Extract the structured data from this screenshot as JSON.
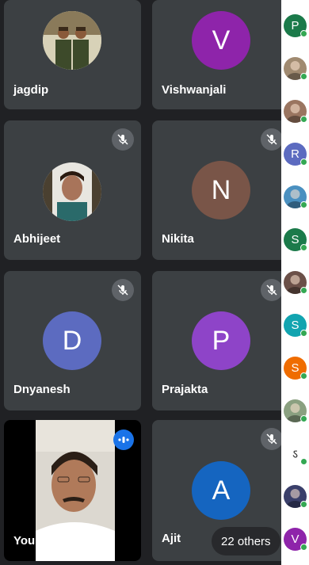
{
  "participants": {
    "jagdip": {
      "name": "jagdip"
    },
    "vishwanjali": {
      "name": "Vishwanjali",
      "initial": "V",
      "color": "#8e24aa"
    },
    "abhijeet": {
      "name": "Abhijeet"
    },
    "nikita": {
      "name": "Nikita",
      "initial": "N",
      "color": "#795548"
    },
    "dnyanesh": {
      "name": "Dnyanesh",
      "initial": "D",
      "color": "#5c6bc0"
    },
    "prajakta": {
      "name": "Prajakta",
      "initial": "P",
      "color": "#8e44c8"
    },
    "you": {
      "name": "You"
    },
    "ajit": {
      "name": "Ajit",
      "initial": "A",
      "color": "#1565c0"
    }
  },
  "others_label": "22 others",
  "sidebar": {
    "avatars": [
      {
        "kind": "letter",
        "letter": "P",
        "color": "#1b7a4a"
      },
      {
        "kind": "photo",
        "color": "#a08a70"
      },
      {
        "kind": "photo",
        "color": "#9a7560"
      },
      {
        "kind": "letter",
        "letter": "R",
        "color": "#5c6bc0"
      },
      {
        "kind": "photo",
        "color": "#4a90c0"
      },
      {
        "kind": "letter",
        "letter": "S",
        "color": "#1b7a4a"
      },
      {
        "kind": "photo",
        "color": "#6b5048"
      },
      {
        "kind": "letter",
        "letter": "S",
        "color": "#12a4b0"
      },
      {
        "kind": "letter",
        "letter": "S",
        "color": "#ef6c00"
      },
      {
        "kind": "photo",
        "color": "#8aa080"
      },
      {
        "kind": "letter",
        "letter": "ऽ",
        "color": "#ffffff",
        "text_color": "#333333"
      },
      {
        "kind": "photo",
        "color": "#3a3f6a"
      },
      {
        "kind": "letter",
        "letter": "V",
        "color": "#8e24aa"
      }
    ]
  },
  "icons": {
    "mute": "mic-off-icon",
    "speaking": "audio-level-icon"
  }
}
